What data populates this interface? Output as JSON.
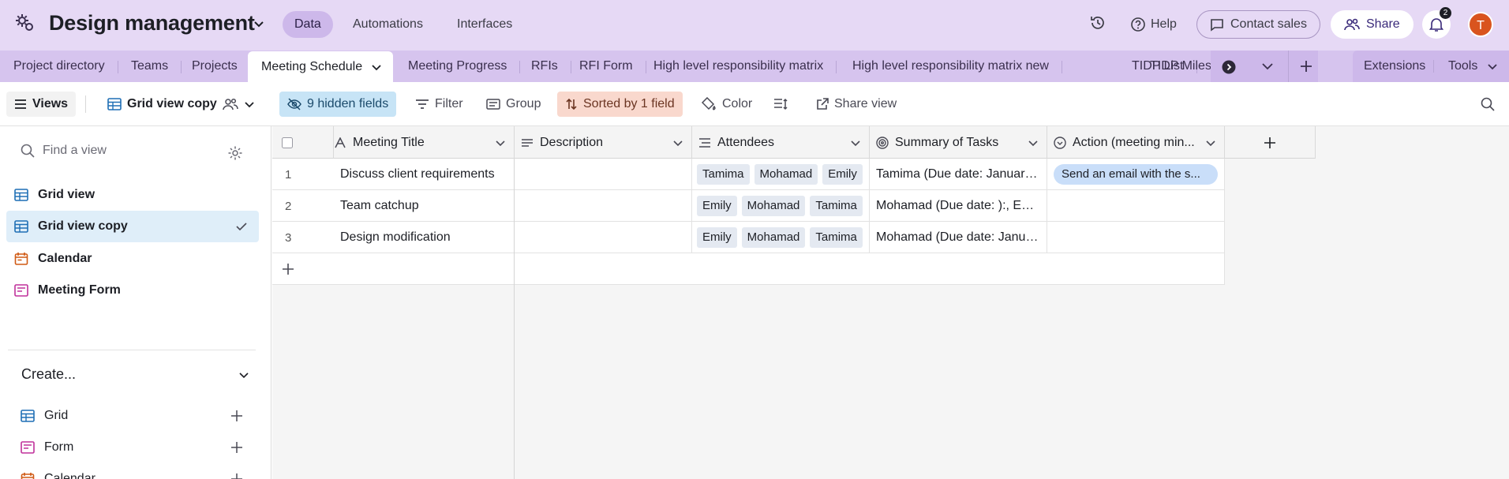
{
  "header": {
    "base_name": "Design management",
    "nav": [
      "Data",
      "Automations",
      "Interfaces"
    ],
    "help_label": "Help",
    "contact_label": "Contact sales",
    "share_label": "Share",
    "notification_count": "2",
    "avatar_initial": "T",
    "accent_color": "#e6d9f5"
  },
  "tables": {
    "items": [
      "Project directory",
      "Teams",
      "Projects",
      "Meeting Schedule",
      "Meeting Progress",
      "RFIs",
      "RFI Form",
      "High level responsibility matrix",
      "High level responsibility matrix new",
      "TIDP List"
    ],
    "overflow_item": "TIDP Miles",
    "extensions_label": "Extensions",
    "tools_label": "Tools"
  },
  "toolbar": {
    "views_label": "Views",
    "view_name": "Grid view copy",
    "hidden_fields": "9 hidden fields",
    "filter": "Filter",
    "group": "Group",
    "sorted": "Sorted by 1 field",
    "color": "Color",
    "share_view": "Share view"
  },
  "sidebar": {
    "search_placeholder": "Find a view",
    "views": [
      {
        "label": "Grid view",
        "icon": "grid-icon"
      },
      {
        "label": "Grid view copy",
        "icon": "grid-icon"
      },
      {
        "label": "Calendar",
        "icon": "calendar-icon"
      },
      {
        "label": "Meeting Form",
        "icon": "form-icon"
      }
    ],
    "create_label": "Create...",
    "create_items": [
      "Grid",
      "Form",
      "Calendar"
    ]
  },
  "grid": {
    "columns": [
      "Meeting Title",
      "Description",
      "Attendees",
      "Summary of Tasks",
      "Action (meeting min..."
    ],
    "rows": [
      {
        "num": "1",
        "title": "Discuss client requirements",
        "attendees": [
          "Tamima",
          "Mohamad",
          "Emily"
        ],
        "summary": "Tamima (Due date: January ...",
        "action": "Send an email with the s..."
      },
      {
        "num": "2",
        "title": "Team catchup",
        "attendees": [
          "Emily",
          "Mohamad",
          "Tamima"
        ],
        "summary": "Mohamad (Due date: ):, Em...",
        "action": ""
      },
      {
        "num": "3",
        "title": "Design modification",
        "attendees": [
          "Emily",
          "Mohamad",
          "Tamima"
        ],
        "summary": "Mohamad (Due date: Janua...",
        "action": ""
      }
    ]
  }
}
